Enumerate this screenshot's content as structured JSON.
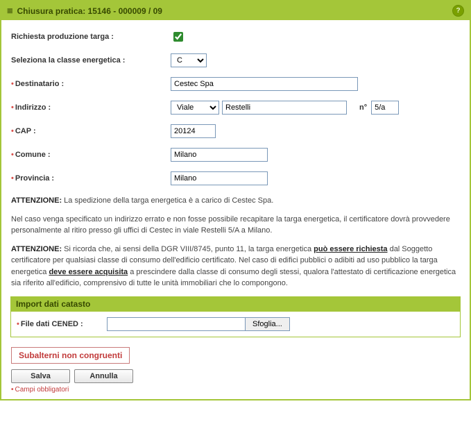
{
  "header": {
    "title": "Chiusura pratica: 15146 - 000009 / 09",
    "help_icon": "?"
  },
  "form": {
    "targa_label": "Richiesta produzione targa :",
    "targa_checked": true,
    "classe_label": "Seleziona la classe energetica :",
    "classe_value": "C",
    "destinatario_label": "Destinatario :",
    "destinatario_value": "Cestec Spa",
    "indirizzo_label": "Indirizzo :",
    "indirizzo_tipo": "Viale",
    "indirizzo_via": "Restelli",
    "indirizzo_n_label": "n°",
    "indirizzo_num": "5/a",
    "cap_label": "CAP :",
    "cap_value": "20124",
    "comune_label": "Comune :",
    "comune_value": "Milano",
    "provincia_label": "Provincia :",
    "provincia_value": "Milano"
  },
  "texts": {
    "p1_b": "ATTENZIONE:",
    "p1": " La spedizione della targa energetica è a carico di Cestec Spa.",
    "p2": "Nel caso venga specificato un indirizzo errato e non fosse possibile recapitare la targa energetica, il certificatore dovrà provvedere personalmente al ritiro presso gli uffici di Cestec in viale Restelli 5/A a Milano.",
    "p3_b": "ATTENZIONE:",
    "p3_a": " Si ricorda che, ai sensi della DGR VIII/8745, punto 11, la targa energetica ",
    "p3_u1": "può essere richiesta",
    "p3_c": " dal Soggetto certificatore per qualsiasi classe di consumo dell'edificio certificato. Nel caso di edifici pubblici o adibiti ad uso pubblico la targa energetica ",
    "p3_u2": "deve essere acquisita",
    "p3_d": " a prescindere dalla classe di consumo degli stessi, qualora l'attestato di certificazione energetica sia riferito all'edificio, comprensivo di tutte le unità immobiliari che lo compongono."
  },
  "import": {
    "header": "Import dati catasto",
    "file_label": "File dati CENED :",
    "browse": "Sfoglia..."
  },
  "footer": {
    "warn": "Subalterni non congruenti",
    "save": "Salva",
    "cancel": "Annulla",
    "mandatory": "Campi obbligatori"
  }
}
